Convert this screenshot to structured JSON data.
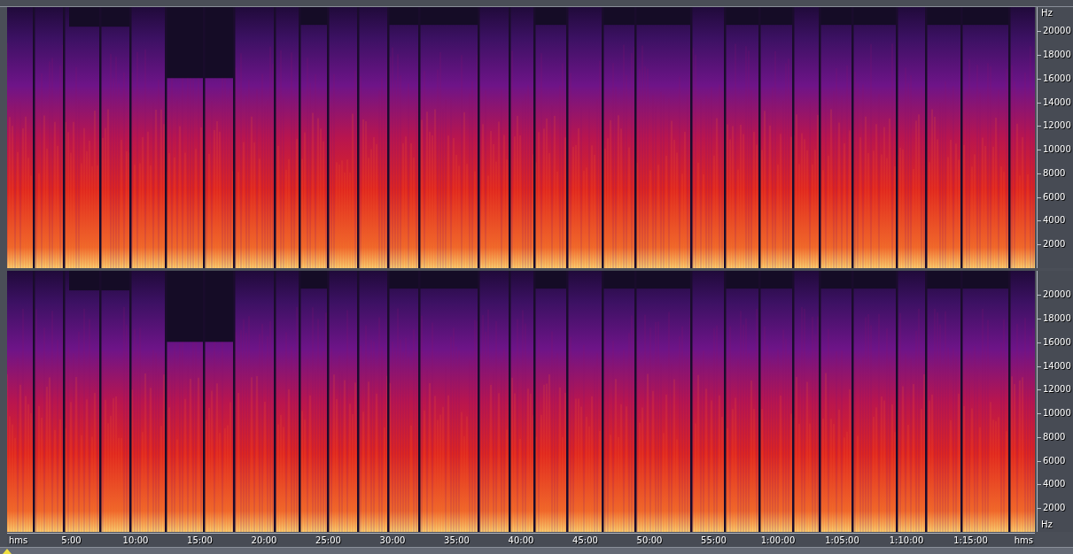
{
  "channels": [
    {
      "hz_axis": {
        "unit_top": "Hz",
        "labels": [
          "20000",
          "18000",
          "16000",
          "14000",
          "12000",
          "10000",
          "8000",
          "6000",
          "4000",
          "2000"
        ]
      }
    },
    {
      "hz_axis": {
        "unit_bottom": "Hz",
        "labels": [
          "20000",
          "18000",
          "16000",
          "14000",
          "12000",
          "10000",
          "8000",
          "6000",
          "4000",
          "2000"
        ]
      }
    }
  ],
  "time_axis": {
    "unit_left": "hms",
    "labels": [
      "5:00",
      "10:00",
      "15:00",
      "20:00",
      "25:00",
      "30:00",
      "35:00",
      "40:00",
      "45:00",
      "50:00",
      "55:00",
      "1:00:00",
      "1:05:00",
      "1:10:00",
      "1:15:00"
    ],
    "unit_right": "hms"
  }
}
